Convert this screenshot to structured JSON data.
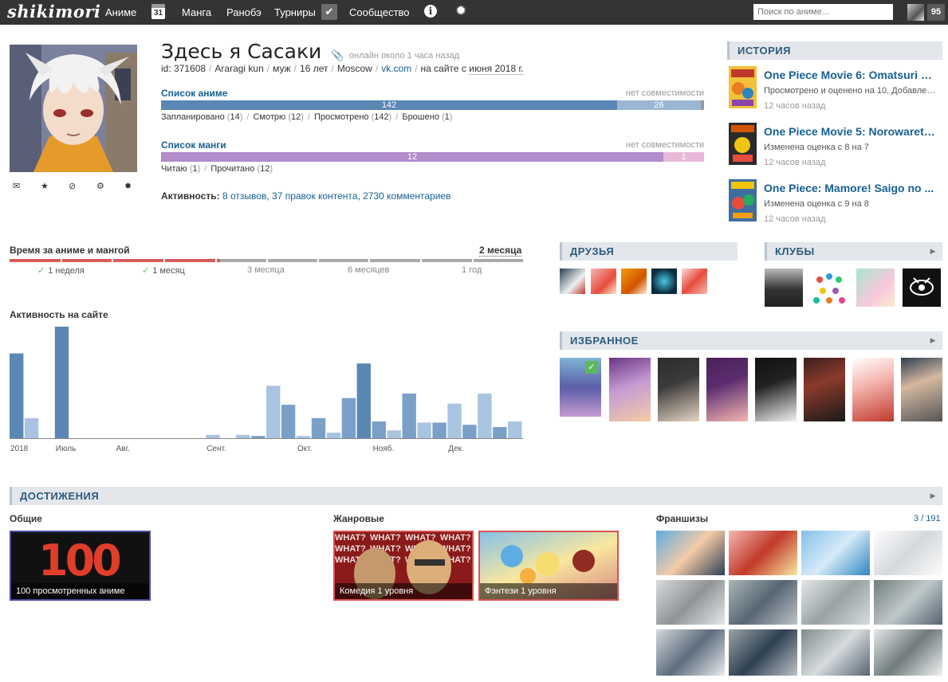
{
  "topbar": {
    "logo": "shikimori",
    "nav": [
      "Аниме",
      "Манга",
      "Ранобэ",
      "Турниры",
      "Сообщество"
    ],
    "calendar_day": "31",
    "check_glyph": "✔",
    "info_glyph": "i",
    "settings_glyph": "✹",
    "search_placeholder": "Поиск по аниме...",
    "notifications_count": "95"
  },
  "profile": {
    "name": "Здесь я Сасаки",
    "online": "онлайн около 1 часа назад",
    "id": "id: 371608",
    "nickname": "Araragi kun",
    "gender": "муж",
    "age": "16 лет",
    "city": "Moscow",
    "site": "vk.com",
    "since_prefix": "на сайте с",
    "since": "июня 2018 г.",
    "actions": [
      "✉",
      "★",
      "⊘",
      "⚙",
      "✹"
    ]
  },
  "anime_list": {
    "title": "Список аниме",
    "compat": "нет совместимости",
    "bar": [
      {
        "label": "142",
        "fraction": 0.84,
        "color": "#5b87b5"
      },
      {
        "label": "26",
        "fraction": 0.154,
        "color": "#9bb6d3"
      },
      {
        "label": "",
        "fraction": 0.006,
        "color": "#999999"
      }
    ],
    "stats": [
      {
        "name": "Запланировано",
        "count": "14"
      },
      {
        "name": "Смотрю",
        "count": "12"
      },
      {
        "name": "Просмотрено",
        "count": "142"
      },
      {
        "name": "Брошено",
        "count": "1"
      }
    ]
  },
  "manga_list": {
    "title": "Список манги",
    "compat": "нет совместимости",
    "bar": [
      {
        "label": "12",
        "fraction": 0.925,
        "color": "#b28ccb"
      },
      {
        "label": "1",
        "fraction": 0.075,
        "color": "#e8b8d8"
      }
    ],
    "stats": [
      {
        "name": "Читаю",
        "count": "1"
      },
      {
        "name": "Прочитано",
        "count": "12"
      }
    ]
  },
  "activity": {
    "label": "Активность:",
    "items": [
      "8 отзывов",
      "37 правок контента",
      "2730 комментариев"
    ]
  },
  "history": {
    "title": "ИСТОРИЯ",
    "items": [
      {
        "title": "One Piece Movie 6: Omatsuri Dan...",
        "desc": "Просмотрено и оценено на 10, Добавлено...",
        "time": "12 часов назад"
      },
      {
        "title": "One Piece Movie 5: Norowareta...",
        "desc": "Изменена оценка с 8 на 7",
        "time": "12 часов назад"
      },
      {
        "title": "One Piece: Mamore! Saigo no ...",
        "desc": "Изменена оценка с 9 на 8",
        "time": "12 часов назад"
      }
    ]
  },
  "time_spent": {
    "title": "Время за аниме и мангой",
    "total": "2 месяца",
    "progress": 0.41,
    "labels": [
      {
        "text": "1 неделя",
        "done": true
      },
      {
        "text": "1 месяц",
        "done": true
      },
      {
        "text": "3 месяца",
        "done": false
      },
      {
        "text": "6 месяцев",
        "done": false
      },
      {
        "text": "1 год",
        "done": false
      }
    ]
  },
  "chart_data": {
    "type": "bar",
    "title": "Активность на сайте",
    "x_labels": [
      "2018",
      "Июль",
      "Авг.",
      "Сент.",
      "Окт.",
      "Нояб.",
      "Дек."
    ],
    "values": [
      76,
      18,
      0,
      100,
      0,
      0,
      0,
      0,
      0,
      0,
      0,
      0,
      0,
      3,
      0,
      3,
      2,
      47,
      30,
      2,
      18,
      5,
      36,
      67,
      15,
      7,
      40,
      14,
      14,
      31,
      12,
      40,
      10,
      15
    ],
    "ylim": [
      0,
      100
    ],
    "colors": {
      "dark": "#7ba0c8",
      "light": "#a9c4e0",
      "peak": "#5b87b5"
    }
  },
  "friends": {
    "title": "ДРУЗЬЯ"
  },
  "clubs": {
    "title": "КЛУБЫ"
  },
  "favorites": {
    "title": "ИЗБРАННОЕ"
  },
  "achievements": {
    "title": "ДОСТИЖЕНИЯ",
    "common_title": "Общие",
    "common": [
      {
        "label": "100 просмотренных аниме",
        "logo": "100"
      }
    ],
    "genre_title": "Жанровые",
    "genre": [
      {
        "label": "Комедия 1 уровня",
        "bg_text": "WHAT? WHAT? WHAT? WHAT? WHAT? WHAT? WHAT? WHAT? WHAT? WHAT? WHAT? WHAT?"
      },
      {
        "label": "Фэнтези 1 уровня"
      }
    ],
    "franchise_title": "Франшизы",
    "franchise_count": "3 / 191"
  }
}
